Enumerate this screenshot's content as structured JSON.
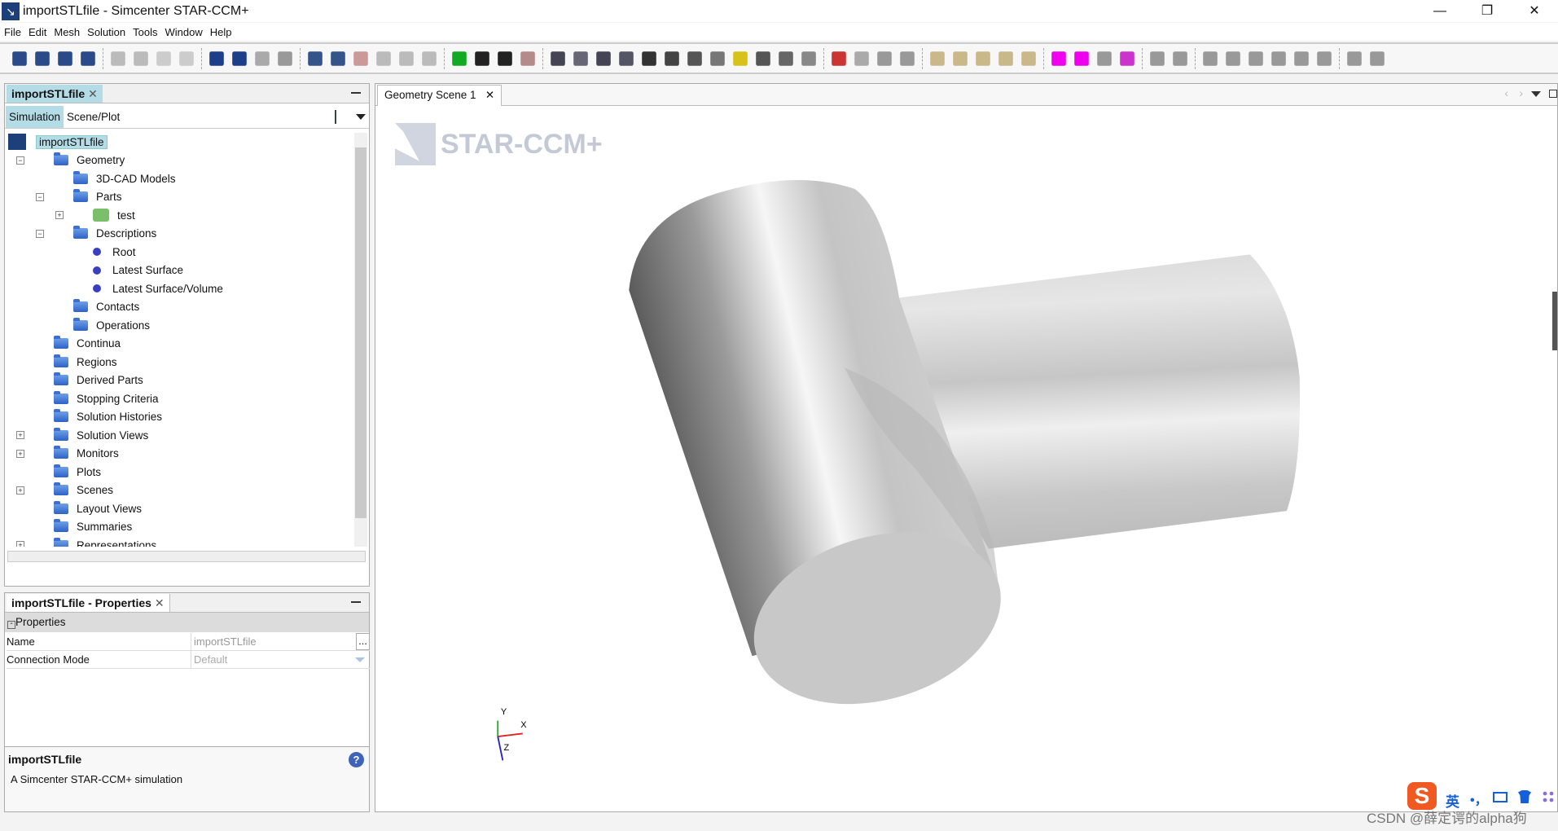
{
  "window": {
    "title": "importSTLfile - Simcenter STAR-CCM+",
    "minimize": "—",
    "restore": "❐",
    "close": "✕"
  },
  "menu": [
    "File",
    "Edit",
    "Mesh",
    "Solution",
    "Tools",
    "Window",
    "Help"
  ],
  "toolbar": {
    "icons": [
      {
        "name": "new-simulation-icon",
        "color": "#2a4a8a"
      },
      {
        "name": "open-icon",
        "color": "#2a4a8a"
      },
      {
        "name": "save-icon",
        "color": "#2a4a8a"
      },
      {
        "name": "save-as-icon",
        "color": "#2a4a8a"
      },
      {
        "sep": true
      },
      {
        "name": "copy-icon",
        "color": "#bbb"
      },
      {
        "name": "paste-icon",
        "color": "#bbb"
      },
      {
        "name": "back-icon",
        "color": "#ccc"
      },
      {
        "name": "forward-icon",
        "color": "#ccc"
      },
      {
        "sep": true
      },
      {
        "name": "run-icon",
        "color": "#1d3f8a"
      },
      {
        "name": "step-icon",
        "color": "#1d3f8a"
      },
      {
        "name": "pause-icon",
        "color": "#aaa"
      },
      {
        "name": "stop-icon",
        "color": "#999"
      },
      {
        "sep": true
      },
      {
        "name": "mesh-icon",
        "color": "#34548a"
      },
      {
        "name": "clear-mesh-icon",
        "color": "#34548a"
      },
      {
        "name": "delete-mesh-icon",
        "color": "#c99"
      },
      {
        "name": "surface-icon",
        "color": "#bbb"
      },
      {
        "name": "volume-icon",
        "color": "#bbb"
      },
      {
        "name": "grid-icon",
        "color": "#bbb"
      },
      {
        "sep": true
      },
      {
        "name": "flag-icon",
        "color": "#11aa22"
      },
      {
        "name": "walk-icon",
        "color": "#222"
      },
      {
        "name": "run-person-icon",
        "color": "#222"
      },
      {
        "name": "record-icon",
        "color": "#b58a8a"
      },
      {
        "sep": true
      },
      {
        "name": "scene-icon",
        "color": "#445"
      },
      {
        "name": "fit-icon",
        "color": "#667"
      },
      {
        "name": "reset-view-icon",
        "color": "#445"
      },
      {
        "name": "select-icon",
        "color": "#556"
      },
      {
        "name": "camera-icon",
        "color": "#333"
      },
      {
        "name": "arrow-left-icon",
        "color": "#444"
      },
      {
        "name": "arrow-right-icon",
        "color": "#555"
      },
      {
        "name": "transform-icon",
        "color": "#777"
      },
      {
        "name": "formula-icon",
        "color": "#d8c21a"
      },
      {
        "name": "ruler-icon",
        "color": "#555"
      },
      {
        "name": "table-icon",
        "color": "#666"
      },
      {
        "name": "table2-icon",
        "color": "#888"
      },
      {
        "sep": true
      },
      {
        "name": "plot-icon",
        "color": "#c33"
      },
      {
        "name": "chart-icon",
        "color": "#aaa"
      },
      {
        "name": "probe-icon",
        "color": "#999"
      },
      {
        "name": "monitor-icon",
        "color": "#999"
      },
      {
        "sep": true
      },
      {
        "name": "play-icon",
        "color": "#c8b88a"
      },
      {
        "name": "stop-anim-icon",
        "color": "#c8b88a"
      },
      {
        "name": "prev-frame-icon",
        "color": "#c8b88a"
      },
      {
        "name": "next-frame-icon",
        "color": "#c8b88a"
      },
      {
        "name": "record-anim-icon",
        "color": "#c8b88a"
      },
      {
        "sep": true
      },
      {
        "name": "region-select-icon",
        "color": "#ee00ee"
      },
      {
        "name": "region-select2-icon",
        "color": "#ee00ee"
      },
      {
        "name": "part-icon",
        "color": "#999"
      },
      {
        "name": "part-dropdown-icon",
        "color": "#cc33cc"
      },
      {
        "sep": true
      },
      {
        "name": "line-icon",
        "color": "#999"
      },
      {
        "name": "axis-icon",
        "color": "#999"
      },
      {
        "sep": true
      },
      {
        "name": "view-1-icon",
        "color": "#999"
      },
      {
        "name": "view-2-icon",
        "color": "#999"
      },
      {
        "name": "view-3-icon",
        "color": "#999"
      },
      {
        "name": "view-4-icon",
        "color": "#999"
      },
      {
        "name": "view-5-icon",
        "color": "#999"
      },
      {
        "name": "view-6-icon",
        "color": "#999"
      },
      {
        "sep": true
      },
      {
        "name": "view-7-icon",
        "color": "#999"
      },
      {
        "name": "view-8-icon",
        "color": "#999"
      }
    ]
  },
  "sim_panel": {
    "tab": "importSTLfile",
    "close": "✕",
    "subtabs": [
      "Simulation",
      "Scene/Plot"
    ],
    "tree": [
      {
        "label": "importSTLfile",
        "level": 0,
        "type": "root"
      },
      {
        "label": "Geometry",
        "level": 1,
        "type": "folder",
        "exp": "-"
      },
      {
        "label": "3D-CAD Models",
        "level": 2,
        "type": "folder"
      },
      {
        "label": "Parts",
        "level": 2,
        "type": "folder",
        "exp": "-"
      },
      {
        "label": "test",
        "level": 3,
        "type": "part",
        "exp": "+"
      },
      {
        "label": "Descriptions",
        "level": 2,
        "type": "folder",
        "exp": "-"
      },
      {
        "label": "Root",
        "level": 3,
        "type": "bullet"
      },
      {
        "label": "Latest Surface",
        "level": 3,
        "type": "bullet"
      },
      {
        "label": "Latest Surface/Volume",
        "level": 3,
        "type": "bullet"
      },
      {
        "label": "Contacts",
        "level": 2,
        "type": "folder"
      },
      {
        "label": "Operations",
        "level": 2,
        "type": "folder"
      },
      {
        "label": "Continua",
        "level": 1,
        "type": "folder"
      },
      {
        "label": "Regions",
        "level": 1,
        "type": "folder"
      },
      {
        "label": "Derived Parts",
        "level": 1,
        "type": "folder"
      },
      {
        "label": "Stopping Criteria",
        "level": 1,
        "type": "folder"
      },
      {
        "label": "Solution Histories",
        "level": 1,
        "type": "folder"
      },
      {
        "label": "Solution Views",
        "level": 1,
        "type": "folder",
        "exp": "+"
      },
      {
        "label": "Monitors",
        "level": 1,
        "type": "folder",
        "exp": "+"
      },
      {
        "label": "Plots",
        "level": 1,
        "type": "folder"
      },
      {
        "label": "Scenes",
        "level": 1,
        "type": "folder",
        "exp": "+"
      },
      {
        "label": "Layout Views",
        "level": 1,
        "type": "folder"
      },
      {
        "label": "Summaries",
        "level": 1,
        "type": "folder"
      },
      {
        "label": "Representations",
        "level": 1,
        "type": "folder",
        "exp": "+"
      }
    ]
  },
  "properties": {
    "tab": "importSTLfile - Properties",
    "close": "✕",
    "section": "Properties",
    "rows": [
      {
        "label": "Name",
        "value": "importSTLfile",
        "button": "..."
      },
      {
        "label": "Connection Mode",
        "value": "Default"
      }
    ],
    "desc_title": "importSTLfile",
    "desc_text": "A Simcenter STAR-CCM+ simulation",
    "help": "?"
  },
  "scene": {
    "tab": "Geometry Scene 1",
    "close": "✕",
    "watermark": "STAR-CCM+",
    "axes": {
      "x": "X",
      "y": "Y",
      "z": "Z"
    },
    "body_color": "#c8c8c8"
  },
  "tray": {
    "ime": "S",
    "lang": "英",
    "punct": "•，"
  },
  "watermark_text": "CSDN @薛定谔的alpha狗"
}
